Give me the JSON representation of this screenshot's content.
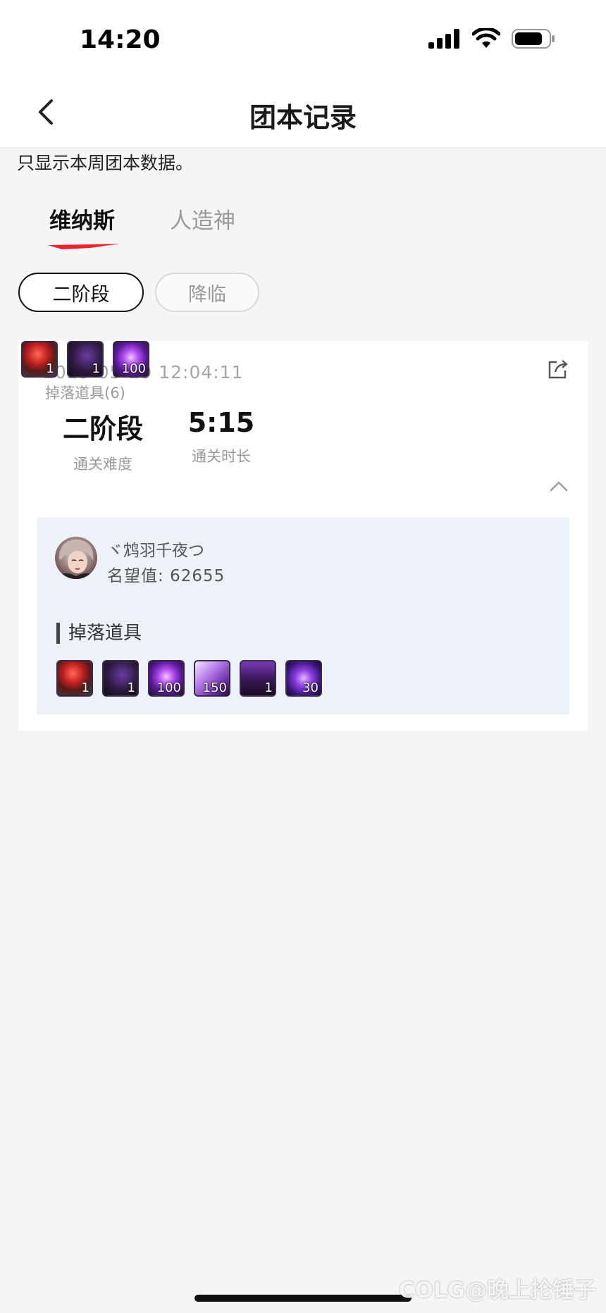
{
  "status_bar": {
    "time": "14:20"
  },
  "nav": {
    "title": "团本记录"
  },
  "notice": "只显示本周团本数据。",
  "tabs": [
    {
      "label": "维纳斯",
      "active": true
    },
    {
      "label": "人造神",
      "active": false
    }
  ],
  "stage_filters": [
    {
      "label": "二阶段",
      "active": true
    },
    {
      "label": "降临",
      "active": false
    }
  ],
  "record": {
    "datetime": "2025-05-29 12:04:11",
    "difficulty_value": "二阶段",
    "difficulty_label": "通关难度",
    "duration_value": "5:15",
    "duration_label": "通关时长",
    "drops_label": "掉落道具(6)",
    "summary_items": [
      {
        "icon": "red-gem-item-icon",
        "count": "1"
      },
      {
        "icon": "purple-chain-item-icon",
        "count": "1"
      },
      {
        "icon": "purple-orb-item-icon",
        "count": "100"
      }
    ],
    "player": {
      "name": "ヾ鸩羽千夜つ",
      "fame_label": "名望值:",
      "fame_value": "62655"
    },
    "drops_heading": "掉落道具",
    "detail_items": [
      {
        "icon": "red-gem-item-icon",
        "count": "1"
      },
      {
        "icon": "purple-chain-item-icon",
        "count": "1"
      },
      {
        "icon": "purple-orb-item-icon",
        "count": "100"
      },
      {
        "icon": "purple-wing-item-icon",
        "count": "150"
      },
      {
        "icon": "purple-box-item-icon",
        "count": "1"
      },
      {
        "icon": "purple-swirl-item-icon",
        "count": "30"
      }
    ]
  },
  "watermark": "COLG@晚上抡锤子",
  "colors": {
    "accent": "#e8242f",
    "detail_bg": "#edf1f8"
  }
}
